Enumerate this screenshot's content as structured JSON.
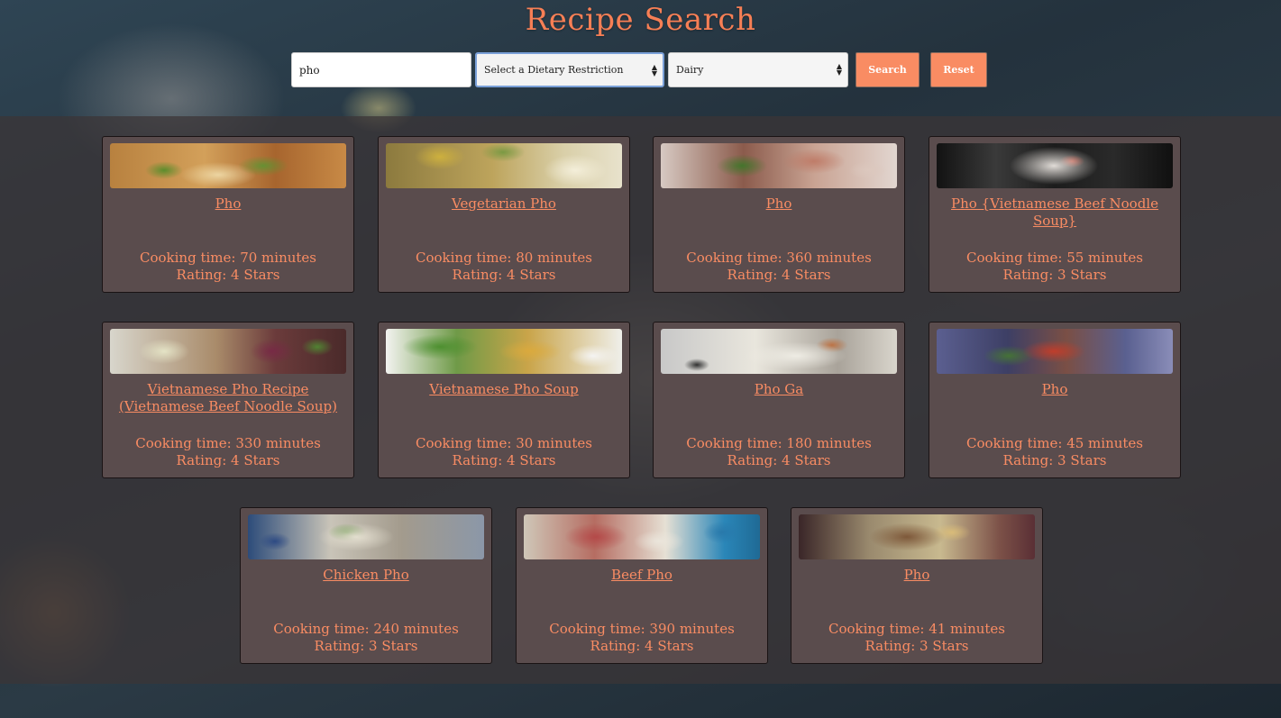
{
  "header": {
    "title": "Recipe Search",
    "search_value": "pho",
    "diet_select": "Select a Dietary Restriction",
    "allergy_select": "Dairy",
    "search_label": "Search",
    "reset_label": "Reset"
  },
  "colors": {
    "accent": "#f98c63",
    "card_bg": "#5a4c4d",
    "panel_overlay": "#3c3436"
  },
  "recipes": [
    {
      "title": "Pho",
      "time": "Cooking time: 70 minutes",
      "rating": "Rating: 4 Stars"
    },
    {
      "title": "Vegetarian Pho",
      "time": "Cooking time: 80 minutes",
      "rating": "Rating: 4 Stars"
    },
    {
      "title": "Pho",
      "time": "Cooking time: 360 minutes",
      "rating": "Rating: 4 Stars"
    },
    {
      "title": "Pho {Vietnamese Beef Noodle Soup}",
      "time": "Cooking time: 55 minutes",
      "rating": "Rating: 3 Stars"
    },
    {
      "title": "Vietnamese Pho Recipe (Vietnamese Beef Noodle Soup)",
      "time": "Cooking time: 330 minutes",
      "rating": "Rating: 4 Stars"
    },
    {
      "title": "Vietnamese Pho Soup",
      "time": "Cooking time: 30 minutes",
      "rating": "Rating: 4 Stars"
    },
    {
      "title": "Pho Ga",
      "time": "Cooking time: 180 minutes",
      "rating": "Rating: 4 Stars"
    },
    {
      "title": "Pho",
      "time": "Cooking time: 45 minutes",
      "rating": "Rating: 3 Stars"
    },
    {
      "title": "Chicken Pho",
      "time": "Cooking time: 240 minutes",
      "rating": "Rating: 3 Stars"
    },
    {
      "title": "Beef Pho",
      "time": "Cooking time: 390 minutes",
      "rating": "Rating: 4 Stars"
    },
    {
      "title": "Pho",
      "time": "Cooking time: 41 minutes",
      "rating": "Rating: 3 Stars"
    }
  ]
}
